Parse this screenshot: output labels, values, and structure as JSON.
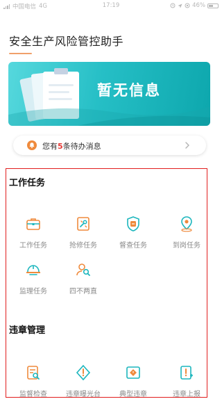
{
  "status_bar": {
    "carrier": "中国电信",
    "network": "4G",
    "time": "17:19",
    "battery": "46%"
  },
  "header": {
    "title": "安全生产风险管控助手"
  },
  "banner": {
    "text": "暂无信息"
  },
  "notice": {
    "prefix": "您有",
    "count": "5",
    "suffix": "条待办消息"
  },
  "sections": {
    "work": {
      "title": "工作任务",
      "items": [
        {
          "label": "工作任务",
          "icon": "briefcase-icon"
        },
        {
          "label": "抢修任务",
          "icon": "repair-tools-icon"
        },
        {
          "label": "督查任务",
          "icon": "inspection-badge-icon"
        },
        {
          "label": "到岗任务",
          "icon": "location-pin-icon"
        },
        {
          "label": "监理任务",
          "icon": "safety-helmet-icon"
        },
        {
          "label": "四不两直",
          "icon": "person-search-icon"
        }
      ]
    },
    "violation": {
      "title": "违章管理",
      "items": [
        {
          "label": "监督检查",
          "icon": "document-search-icon"
        },
        {
          "label": "违章曝光台",
          "icon": "warning-shield-icon"
        },
        {
          "label": "典型违章",
          "icon": "typical-violation-icon"
        },
        {
          "label": "违章上报",
          "icon": "report-alert-icon"
        }
      ]
    }
  },
  "colors": {
    "accent": "#ef8a3c",
    "banner_start": "#56d8dd",
    "banner_end": "#0da7ad",
    "highlight_border": "#e11d1d",
    "count_red": "#e53935"
  }
}
